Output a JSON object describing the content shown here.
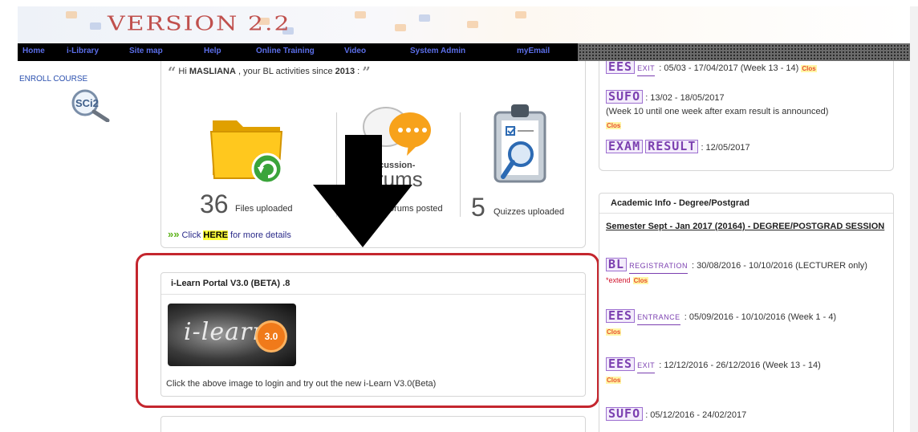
{
  "banner": {
    "version_text": "VERSION 2.2"
  },
  "nav": {
    "items": [
      "Home",
      "i-Library",
      "Site map",
      "Help",
      "Online Training",
      "Video",
      "System Admin",
      "myEmail"
    ]
  },
  "left": {
    "enroll_label": "ENROLL COURSE",
    "logo_text": "SCi2"
  },
  "bl_activity": {
    "greeting_prefix": "Hi ",
    "user": "MASLIANA",
    "greeting_middle": " , your BL activities since ",
    "since_year": "2013",
    "greeting_suffix": " :",
    "files_count": "36",
    "files_label": "Files uploaded",
    "forums_logo_text_1": "iscussion-",
    "forums_logo_text_2": "rums",
    "forums_label": "orums posted",
    "quizzes_count": "5",
    "quizzes_label": "Quizzes uploaded",
    "more_prefix": "Click ",
    "more_link": "HERE",
    "more_suffix": " for more details"
  },
  "ilearn": {
    "title": "i-Learn Portal V3.0 (BETA) .8",
    "logo_text": "i-learn",
    "badge": "3.0",
    "caption": "Click the above image to login and try out the new i-Learn V3.0(Beta)"
  },
  "right_top": {
    "e1_tag_sub": "EXIT",
    "e1_dates": ": 05/03 - 17/04/2017 (Week 13 - 14)",
    "e2_tag": "SUFO",
    "e2_dates": ": 13/02 - 18/05/2017",
    "e2_note": "(Week 10 until one week after exam result is announced)",
    "clos": "Clos",
    "e3_tag_1": "EXAM",
    "e3_tag_2": "RESULT",
    "e3_date": ": 12/05/2017"
  },
  "academic": {
    "header": "Academic Info - Degree/Postgrad",
    "semester": "Semester Sept - Jan 2017 (20164) - DEGREE/POSTGRAD SESSION",
    "entries": [
      {
        "tag": "BL",
        "sub": "REGISTRATION",
        "text": ": 30/08/2016 - 10/10/2016 (LECTURER only)",
        "extend": "*extend",
        "clos": "Clos"
      },
      {
        "tag": "EES",
        "sub": "ENTRANCE",
        "text": ": 05/09/2016 - 10/10/2016 (Week 1 - 4)",
        "clos": "Clos"
      },
      {
        "tag": "EES",
        "sub": "EXIT",
        "text": ": 12/12/2016 - 26/12/2016 (Week 13 - 14)",
        "clos": "Clos"
      },
      {
        "tag": "SUFO",
        "text": ": 05/12/2016 - 24/02/2017"
      }
    ]
  }
}
